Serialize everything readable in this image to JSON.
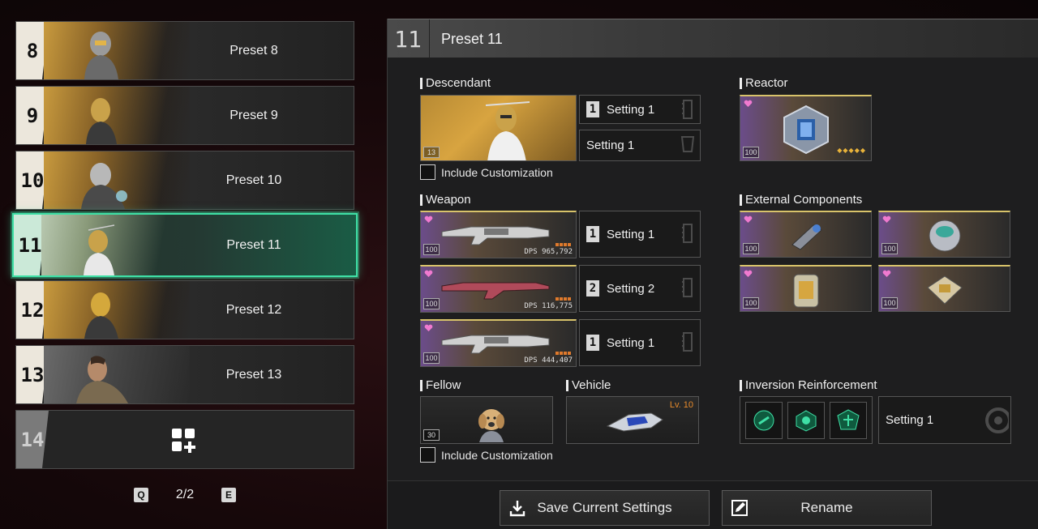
{
  "preset_list": {
    "items": [
      {
        "number": "8",
        "label": "Preset 8"
      },
      {
        "number": "9",
        "label": "Preset 9"
      },
      {
        "number": "10",
        "label": "Preset 10"
      },
      {
        "number": "11",
        "label": "Preset 11",
        "active": true
      },
      {
        "number": "12",
        "label": "Preset 12"
      },
      {
        "number": "13",
        "label": "Preset 13"
      }
    ],
    "empty_slot_number": "14",
    "add_icon": "add-grid-icon"
  },
  "pager": {
    "prev_key": "Q",
    "next_key": "E",
    "pages": "2/2"
  },
  "panel": {
    "number": "11",
    "title": "Preset 11",
    "descendant": {
      "title": "Descendant",
      "level": "13",
      "setting_module_number": "1",
      "setting_module": "Setting 1",
      "setting_second": "Setting 1",
      "include_customization": "Include Customization"
    },
    "reactor": {
      "title": "Reactor",
      "level": "100"
    },
    "weapon": {
      "title": "Weapon",
      "items": [
        {
          "dps": "DPS 965,792",
          "level": "100",
          "setting_number": "1",
          "setting": "Setting 1"
        },
        {
          "dps": "DPS 116,775",
          "level": "100",
          "setting_number": "2",
          "setting": "Setting 2"
        },
        {
          "dps": "DPS 444,407",
          "level": "100",
          "setting_number": "1",
          "setting": "Setting 1"
        }
      ]
    },
    "external": {
      "title": "External Components",
      "items": [
        {
          "level": "100"
        },
        {
          "level": "100"
        },
        {
          "level": "100"
        },
        {
          "level": "100"
        }
      ]
    },
    "fellow": {
      "title": "Fellow",
      "level": "30",
      "include_customization": "Include Customization"
    },
    "vehicle": {
      "title": "Vehicle",
      "level": "Lv. 10"
    },
    "inversion": {
      "title": "Inversion Reinforcement",
      "setting": "Setting 1"
    },
    "buttons": {
      "save": "Save Current Settings",
      "rename": "Rename"
    }
  },
  "colors": {
    "accent": "#3fe0a6",
    "gold": "#d8a440",
    "legendary_purple": "#6b4c8a"
  }
}
